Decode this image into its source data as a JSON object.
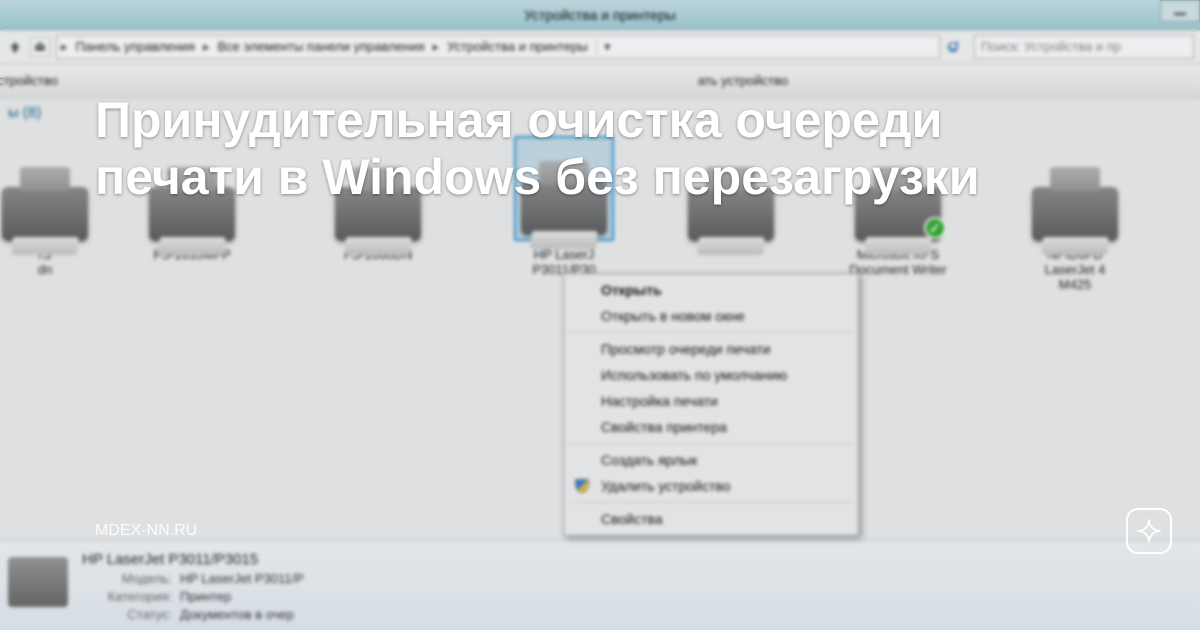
{
  "window": {
    "title": "Устройства и принтеры"
  },
  "breadcrumb": {
    "items": [
      "Панель управления",
      "Все элементы панели управления",
      "Устройства и принтеры"
    ]
  },
  "search": {
    "placeholder": "Поиск: Устройства и пр"
  },
  "toolbar": {
    "items": [
      "е устройство",
      "ать устройство"
    ]
  },
  "section": {
    "label_suffix": "ы",
    "count": "(8)"
  },
  "devices": [
    {
      "line1": "/S",
      "line2": "dn"
    },
    {
      "line1": "FS-1035MFP",
      "line2": ""
    },
    {
      "line1": "FS-1060DN",
      "line2": ""
    },
    {
      "line1": "HP LaserJ",
      "line2": "P3011/P30",
      "selected": true
    },
    {
      "line1": "",
      "line2": ""
    },
    {
      "line1": "Microsoft XPS",
      "line2": "Document Writer",
      "default": true
    },
    {
      "line1": "NPID6FD",
      "line2": "LaserJet 4",
      "line3": "M425"
    }
  ],
  "context_menu": {
    "groups": [
      [
        {
          "label": "Открыть",
          "bold": true
        },
        {
          "label": "Открыть в новом окне"
        }
      ],
      [
        {
          "label": "Просмотр очереди печати"
        },
        {
          "label": "Использовать по умолчанию"
        },
        {
          "label": "Настройка печати"
        },
        {
          "label": "Свойства принтера"
        }
      ],
      [
        {
          "label": "Создать ярлык"
        },
        {
          "label": "Удалить устройство",
          "shield": true
        }
      ],
      [
        {
          "label": "Свойства"
        }
      ]
    ]
  },
  "details": {
    "name": "HP LaserJet P3011/P3015",
    "rows": [
      {
        "label": "Модель:",
        "value": "HP LaserJet P3011/P"
      },
      {
        "label": "Категория:",
        "value": "Принтер"
      },
      {
        "label": "Статус:",
        "value": "Документов в очер"
      }
    ]
  },
  "overlay": {
    "headline": "Принудительная очистка очереди печати в Windows без перезагрузки",
    "source": "MDEX-NN.RU"
  }
}
